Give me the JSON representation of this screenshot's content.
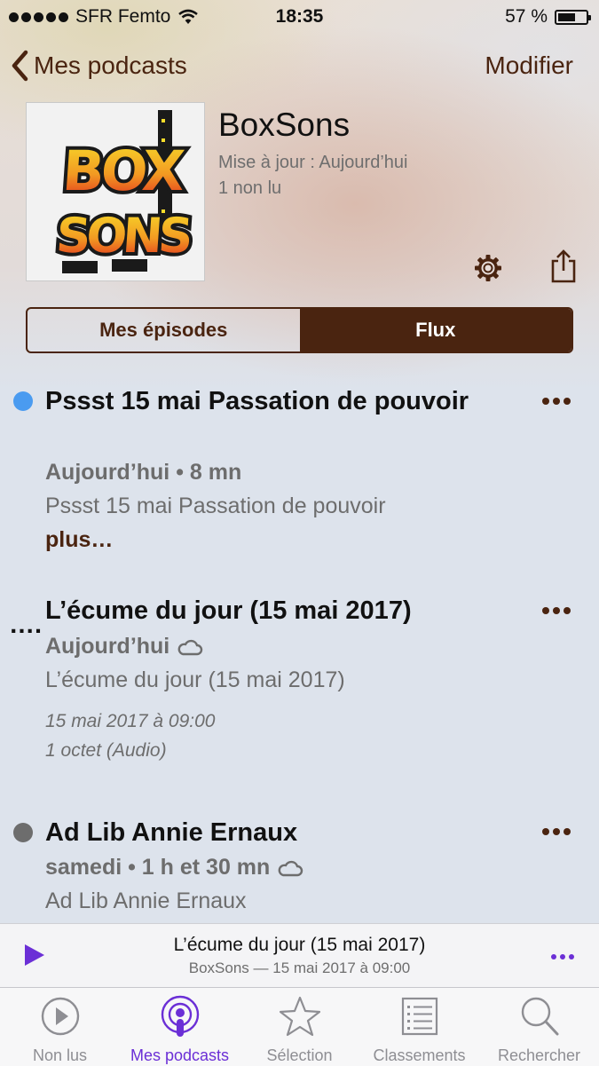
{
  "status_bar": {
    "carrier": "SFR Femto",
    "time": "18:35",
    "battery": "57 %"
  },
  "nav": {
    "back_label": "Mes podcasts",
    "edit_label": "Modifier"
  },
  "podcast": {
    "title": "BoxSons",
    "updated": "Mise à jour : Aujourd’hui",
    "unread": "1 non lu",
    "art_line1": "BOX",
    "art_line2": "SONS"
  },
  "segments": {
    "my_episodes": "Mes épisodes",
    "feed": "Flux",
    "selected": "Flux"
  },
  "episodes": [
    {
      "title": "Pssst 15 mai Passation de pouvoir",
      "meta": "Aujourd’hui • 8 mn",
      "description": "Pssst 15 mai Passation de pouvoir",
      "more": "plus…",
      "status_color": "#4a9bf0"
    },
    {
      "prefix": "….",
      "title": "L’écume du jour (15 mai 2017)",
      "meta": "Aujourd’hui",
      "description": "L’écume du jour (15 mai 2017)",
      "date": "15 mai 2017 à 09:00",
      "size": "1 octet (Audio)"
    },
    {
      "title": "Ad Lib Annie Ernaux",
      "meta": "samedi • 1 h et 30 mn",
      "description": "Ad Lib Annie Ernaux",
      "status_color": "#6d6d6d"
    }
  ],
  "mini_player": {
    "title": "L’écume du jour (15 mai 2017)",
    "subtitle": "BoxSons — 15 mai 2017 à 09:00"
  },
  "tabs": [
    {
      "label": "Non lus",
      "icon": "play-circle-icon"
    },
    {
      "label": "Mes podcasts",
      "icon": "podcast-icon"
    },
    {
      "label": "Sélection",
      "icon": "star-icon"
    },
    {
      "label": "Classements",
      "icon": "list-icon"
    },
    {
      "label": "Rechercher",
      "icon": "search-icon"
    }
  ],
  "colors": {
    "accent": "#4a2410",
    "player_accent": "#6b2fd6",
    "unplayed_dot": "#4a9bf0"
  }
}
